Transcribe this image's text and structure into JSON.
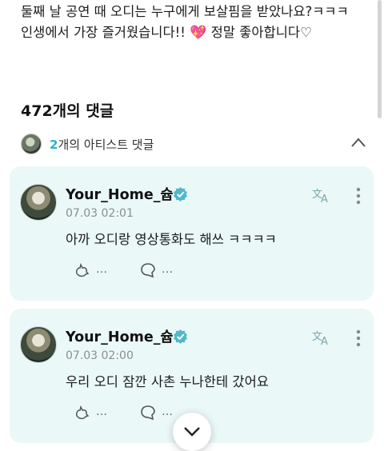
{
  "post": {
    "line1": "둘째 날 공연 때 오디는 누구에게 보살핌을 받았나요?ㅋㅋㅋ",
    "line2_prefix": "인생에서 가장 즐거웠습니다!!",
    "line2_suffix": "정말 좋아합니다♡"
  },
  "comments_header": {
    "count_label": "472개의 댓글"
  },
  "artist_comments": {
    "count": "2",
    "label": "개의 아티스트 댓글"
  },
  "comments": [
    {
      "author": "Your_Home_슙",
      "time": "07.03 02:01",
      "text": "아까 오디랑 영상통화도 해쓰 ㅋㅋㅋㅋ",
      "like_count": "…",
      "reply_count": "…"
    },
    {
      "author": "Your_Home_슙",
      "time": "07.03 02:00",
      "text": "우리 오디 잠깐 사촌 누나한테 갔어요",
      "like_count": "…",
      "reply_count": "…"
    }
  ],
  "icons": {
    "heart": "sparkling-heart-icon",
    "verified": "verified-badge-icon",
    "translate": "translate-icon",
    "more": "more-vertical-icon",
    "like": "cat-paw-like-icon",
    "reply": "speech-bubble-icon",
    "collapse": "chevron-up-icon",
    "scroll": "chevron-down-icon"
  },
  "colors": {
    "accent": "#25b4c4",
    "card_bg": "#eaf8f7",
    "heart": "#e3448a"
  }
}
